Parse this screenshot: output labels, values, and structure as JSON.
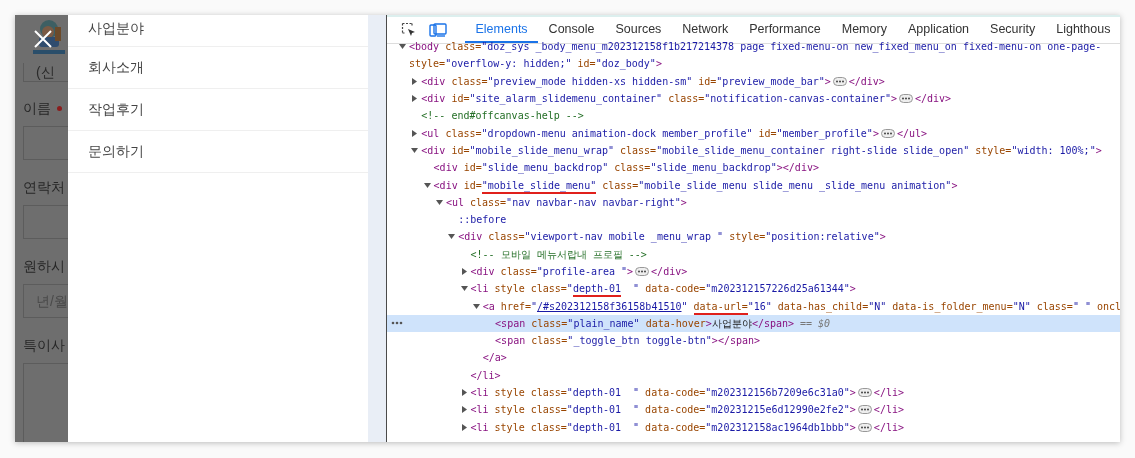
{
  "background_page": {
    "form_items": [
      {
        "kind": "field",
        "value": "(신"
      },
      {
        "kind": "label",
        "text": "이름",
        "required": true
      },
      {
        "kind": "field"
      },
      {
        "kind": "label",
        "text": "연락처"
      },
      {
        "kind": "field"
      },
      {
        "kind": "label",
        "text": "원하시"
      },
      {
        "kind": "field",
        "placeholder": "년/월"
      },
      {
        "kind": "label",
        "text": "특이사"
      },
      {
        "kind": "textarea"
      }
    ]
  },
  "slide_menu": {
    "items": [
      {
        "label": "사업분야"
      },
      {
        "label": "회사소개"
      },
      {
        "label": "작업후기"
      },
      {
        "label": "문의하기"
      }
    ]
  },
  "devtools": {
    "tabs": [
      {
        "label": "Elements",
        "selected": true
      },
      {
        "label": "Console",
        "selected": false
      },
      {
        "label": "Sources",
        "selected": false
      },
      {
        "label": "Network",
        "selected": false
      },
      {
        "label": "Performance",
        "selected": false
      },
      {
        "label": "Memory",
        "selected": false
      },
      {
        "label": "Application",
        "selected": false
      },
      {
        "label": "Security",
        "selected": false
      },
      {
        "label": "Lighthous",
        "selected": false
      }
    ],
    "dom_tree": [
      {
        "expanded": true,
        "selected": false,
        "tokens": [
          {
            "kind": "tag",
            "text": "<body"
          },
          {
            "kind": "attr",
            "text": " class="
          },
          {
            "kind": "value",
            "text": "\"doz_sys _body_menu_m202312158f1b217214378 page fixed-menu-on new_fixed_menu_on fixed-menu-on one-page-"
          }
        ],
        "continuation": [
          {
            "kind": "attr",
            "text": "style="
          },
          {
            "kind": "value",
            "text": "\"overflow-y: hidden;\""
          },
          {
            "kind": "attr",
            "text": " id="
          },
          {
            "kind": "value",
            "text": "\"doz_body\""
          },
          {
            "kind": "tag",
            "text": ">"
          }
        ],
        "children": [
          {
            "expanded": false,
            "selected": false,
            "tokens": [
              {
                "kind": "tag",
                "text": "<div"
              },
              {
                "kind": "attr",
                "text": " class="
              },
              {
                "kind": "value",
                "text": "\"preview_mode hidden-xs hidden-sm\""
              },
              {
                "kind": "attr",
                "text": " id="
              },
              {
                "kind": "value",
                "text": "\"preview_mode_bar\""
              },
              {
                "kind": "tag",
                "text": ">"
              }
            ],
            "close_tokens": [
              {
                "kind": "tag",
                "text": "</div>"
              }
            ]
          },
          {
            "expanded": false,
            "selected": false,
            "tokens": [
              {
                "kind": "tag",
                "text": "<div"
              },
              {
                "kind": "attr",
                "text": " id="
              },
              {
                "kind": "value",
                "text": "\"site_alarm_slidemenu_container\""
              },
              {
                "kind": "attr",
                "text": " class="
              },
              {
                "kind": "value",
                "text": "\"notification-canvas-container\""
              },
              {
                "kind": "tag",
                "text": ">"
              }
            ],
            "close_tokens": [
              {
                "kind": "tag",
                "text": "</div>"
              }
            ]
          },
          {
            "selected": false,
            "tokens": [
              {
                "kind": "comment",
                "text": "<!-- end#offcanvas-help -->"
              }
            ]
          },
          {
            "expanded": false,
            "selected": false,
            "tokens": [
              {
                "kind": "tag",
                "text": "<ul"
              },
              {
                "kind": "attr",
                "text": " class="
              },
              {
                "kind": "value",
                "text": "\"dropdown-menu animation-dock member_profile\""
              },
              {
                "kind": "attr",
                "text": " id="
              },
              {
                "kind": "value",
                "text": "\"member_profile\""
              },
              {
                "kind": "tag",
                "text": ">"
              }
            ],
            "close_tokens": [
              {
                "kind": "tag",
                "text": "</ul>"
              }
            ]
          },
          {
            "expanded": true,
            "selected": false,
            "tokens": [
              {
                "kind": "tag",
                "text": "<div"
              },
              {
                "kind": "attr",
                "text": " id="
              },
              {
                "kind": "value",
                "text": "\"mobile_slide_menu_wrap\""
              },
              {
                "kind": "attr",
                "text": " class="
              },
              {
                "kind": "value",
                "text": "\"mobile_slide_menu_container right-slide slide_open\""
              },
              {
                "kind": "attr",
                "text": " style="
              },
              {
                "kind": "value",
                "text": "\"width: 100%;\""
              },
              {
                "kind": "tag",
                "text": ">"
              }
            ],
            "children": [
              {
                "selected": false,
                "tokens": [
                  {
                    "kind": "tag",
                    "text": "<div"
                  },
                  {
                    "kind": "attr",
                    "text": " id="
                  },
                  {
                    "kind": "value",
                    "text": "\"slide_menu_backdrop\""
                  },
                  {
                    "kind": "attr",
                    "text": " class="
                  },
                  {
                    "kind": "value",
                    "text": "\"slide_menu_backdrop\""
                  },
                  {
                    "kind": "tag",
                    "text": "></div>"
                  }
                ]
              },
              {
                "expanded": true,
                "selected": false,
                "tokens": [
                  {
                    "kind": "tag",
                    "text": "<div"
                  },
                  {
                    "kind": "attr",
                    "text": " id="
                  },
                  {
                    "kind": "value",
                    "text": "\"mobile_slide_menu\"",
                    "underlined": true
                  },
                  {
                    "kind": "attr",
                    "text": " class="
                  },
                  {
                    "kind": "value",
                    "text": "\"mobile_slide_menu slide_menu _slide_menu animation\""
                  },
                  {
                    "kind": "tag",
                    "text": ">"
                  }
                ],
                "children": [
                  {
                    "expanded": true,
                    "selected": false,
                    "tokens": [
                      {
                        "kind": "tag",
                        "text": "<ul"
                      },
                      {
                        "kind": "attr",
                        "text": " class="
                      },
                      {
                        "kind": "value",
                        "text": "\"nav navbar-nav navbar-right\""
                      },
                      {
                        "kind": "tag",
                        "text": ">"
                      }
                    ],
                    "children": [
                      {
                        "selected": false,
                        "tokens": [
                          {
                            "kind": "pseudo",
                            "text": "::before"
                          }
                        ]
                      },
                      {
                        "expanded": true,
                        "selected": false,
                        "tokens": [
                          {
                            "kind": "tag",
                            "text": "<div"
                          },
                          {
                            "kind": "attr",
                            "text": " class="
                          },
                          {
                            "kind": "value",
                            "text": "\"viewport-nav mobile _menu_wrap \""
                          },
                          {
                            "kind": "attr",
                            "text": " style="
                          },
                          {
                            "kind": "value",
                            "text": "\"position:relative\""
                          },
                          {
                            "kind": "tag",
                            "text": ">"
                          }
                        ],
                        "children": [
                          {
                            "selected": false,
                            "tokens": [
                              {
                                "kind": "comment",
                                "text": "<!-- 모바일 메뉴서랍내 프로필 -->"
                              }
                            ]
                          },
                          {
                            "expanded": false,
                            "selected": false,
                            "tokens": [
                              {
                                "kind": "tag",
                                "text": "<div"
                              },
                              {
                                "kind": "attr",
                                "text": " class="
                              },
                              {
                                "kind": "value",
                                "text": "\"profile-area \""
                              },
                              {
                                "kind": "tag",
                                "text": ">"
                              }
                            ],
                            "close_tokens": [
                              {
                                "kind": "tag",
                                "text": "</div>"
                              }
                            ]
                          },
                          {
                            "expanded": true,
                            "selected": false,
                            "tokens": [
                              {
                                "kind": "tag",
                                "text": "<li"
                              },
                              {
                                "kind": "attr",
                                "text": " style class="
                              },
                              {
                                "kind": "value",
                                "text": "\""
                              },
                              {
                                "kind": "value",
                                "text": "depth-01",
                                "underlined": true
                              },
                              {
                                "kind": "value",
                                "text": "  \""
                              },
                              {
                                "kind": "attr",
                                "text": " data-code="
                              },
                              {
                                "kind": "value",
                                "text": "\"m202312157226d25a61344\""
                              },
                              {
                                "kind": "tag",
                                "text": ">"
                              }
                            ],
                            "close_tokens": [
                              {
                                "kind": "tag",
                                "text": "</li>"
                              }
                            ],
                            "children": [
                              {
                                "expanded": true,
                                "selected": false,
                                "tokens": [
                                  {
                                    "kind": "tag",
                                    "text": "<a"
                                  },
                                  {
                                    "kind": "attr",
                                    "text": " href="
                                  },
                                  {
                                    "kind": "value",
                                    "text": "\""
                                  },
                                  {
                                    "kind": "link",
                                    "text": "/#s202312158f36158b41510"
                                  },
                                  {
                                    "kind": "value",
                                    "text": "\" "
                                  },
                                  {
                                    "kind": "attr",
                                    "text": "data-url=",
                                    "underlined": true
                                  },
                                  {
                                    "kind": "value",
                                    "text": "\"16\""
                                  },
                                  {
                                    "kind": "attr",
                                    "text": " data-has_child="
                                  },
                                  {
                                    "kind": "value",
                                    "text": "\"N\""
                                  },
                                  {
                                    "kind": "attr",
                                    "text": " data-is_folder_menu="
                                  },
                                  {
                                    "kind": "value",
                                    "text": "\"N\""
                                  },
                                  {
                                    "kind": "attr",
                                    "text": " class="
                                  },
                                  {
                                    "kind": "value",
                                    "text": "\" \""
                                  },
                                  {
                                    "kind": "attr",
                                    "text": " oncl"
                                  }
                                ],
                                "close_tokens": [
                                  {
                                    "kind": "tag",
                                    "text": "</a>"
                                  }
                                ],
                                "children": [
                                  {
                                    "selected": true,
                                    "console_ref": "== $0",
                                    "tokens": [
                                      {
                                        "kind": "tag",
                                        "text": "<span"
                                      },
                                      {
                                        "kind": "attr",
                                        "text": " class="
                                      },
                                      {
                                        "kind": "value",
                                        "text": "\"plain_name\""
                                      },
                                      {
                                        "kind": "attr",
                                        "text": " data-hover"
                                      },
                                      {
                                        "kind": "tag",
                                        "text": ">"
                                      },
                                      {
                                        "kind": "text",
                                        "text": "사업분야"
                                      },
                                      {
                                        "kind": "tag",
                                        "text": "</span>"
                                      }
                                    ]
                                  },
                                  {
                                    "selected": false,
                                    "tokens": [
                                      {
                                        "kind": "tag",
                                        "text": "<span"
                                      },
                                      {
                                        "kind": "attr",
                                        "text": " class="
                                      },
                                      {
                                        "kind": "value",
                                        "text": "\"_toggle_btn toggle-btn\""
                                      },
                                      {
                                        "kind": "tag",
                                        "text": "></span>"
                                      }
                                    ]
                                  }
                                ]
                              }
                            ]
                          },
                          {
                            "expanded": false,
                            "selected": false,
                            "tokens": [
                              {
                                "kind": "tag",
                                "text": "<li"
                              },
                              {
                                "kind": "attr",
                                "text": " style class="
                              },
                              {
                                "kind": "value",
                                "text": "\"depth-01  \""
                              },
                              {
                                "kind": "attr",
                                "text": " data-code="
                              },
                              {
                                "kind": "value",
                                "text": "\"m202312156b7209e6c31a0\""
                              },
                              {
                                "kind": "tag",
                                "text": ">"
                              }
                            ],
                            "close_tokens": [
                              {
                                "kind": "tag",
                                "text": "</li>"
                              }
                            ]
                          },
                          {
                            "expanded": false,
                            "selected": false,
                            "tokens": [
                              {
                                "kind": "tag",
                                "text": "<li"
                              },
                              {
                                "kind": "attr",
                                "text": " style class="
                              },
                              {
                                "kind": "value",
                                "text": "\"depth-01  \""
                              },
                              {
                                "kind": "attr",
                                "text": " data-code="
                              },
                              {
                                "kind": "value",
                                "text": "\"m20231215e6d12990e2fe2\""
                              },
                              {
                                "kind": "tag",
                                "text": ">"
                              }
                            ],
                            "close_tokens": [
                              {
                                "kind": "tag",
                                "text": "</li>"
                              }
                            ]
                          },
                          {
                            "expanded": false,
                            "selected": false,
                            "tokens": [
                              {
                                "kind": "tag",
                                "text": "<li"
                              },
                              {
                                "kind": "attr",
                                "text": " style class="
                              },
                              {
                                "kind": "value",
                                "text": "\"depth-01  \""
                              },
                              {
                                "kind": "attr",
                                "text": " data-code="
                              },
                              {
                                "kind": "value",
                                "text": "\"m202312158ac1964db1bbb\""
                              },
                              {
                                "kind": "tag",
                                "text": ">"
                              }
                            ],
                            "close_tokens": [
                              {
                                "kind": "tag",
                                "text": "</li>"
                              }
                            ]
                          }
                        ]
                      }
                    ]
                  }
                ]
              }
            ]
          }
        ]
      }
    ]
  }
}
